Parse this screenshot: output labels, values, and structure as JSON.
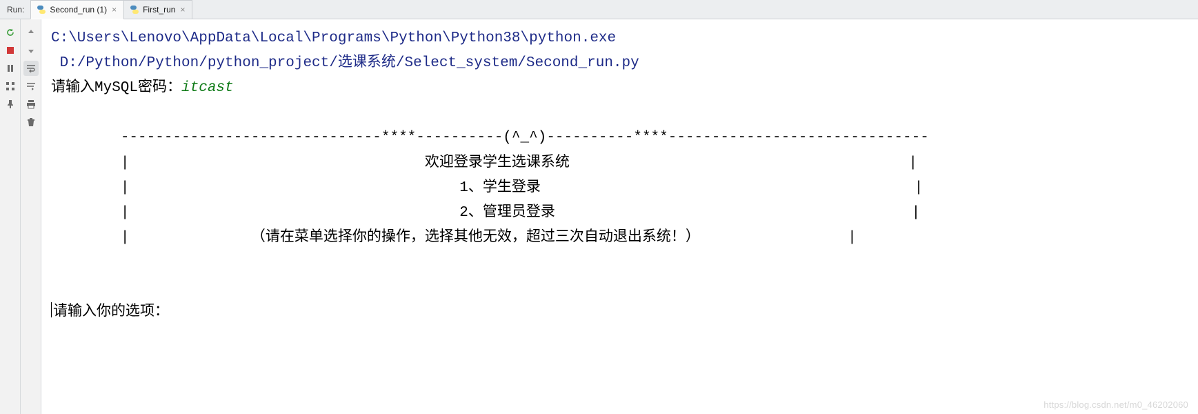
{
  "header": {
    "run_label": "Run:",
    "tabs": [
      {
        "title": "Second_run (1)",
        "icon": "python-icon"
      },
      {
        "title": "First_run",
        "icon": "python-icon"
      }
    ]
  },
  "toolbar_left": [
    "rerun",
    "stop",
    "pause",
    "structure",
    "pin"
  ],
  "toolbar_right": [
    "up",
    "down",
    "toggle-soft-wrap",
    "scroll-to-end",
    "print",
    "delete"
  ],
  "console": {
    "line_exe": "C:\\Users\\Lenovo\\AppData\\Local\\Programs\\Python\\Python38\\python.exe",
    "line_script": " D:/Python/Python/python_project/选课系统/Select_system/Second_run.py",
    "prompt_pwd": "请输入MySQL密码：",
    "input_pwd": "itcast",
    "blank1": "",
    "divider": "        ------------------------------****----------(^_^)----------****------------------------------",
    "menu_title": "        |                                  欢迎登录学生选课系统                                       |",
    "menu_opt1": "        |                                      1、学生登录                                           |",
    "menu_opt2": "        |                                      2、管理员登录                                         |",
    "menu_hint": "        |              （请在菜单选择你的操作，选择其他无效，超过三次自动退出系统！）                 |",
    "blank2": "",
    "blank3": "",
    "prompt_sel": "请输入你的选项："
  },
  "watermark": "https://blog.csdn.net/m0_46202060"
}
